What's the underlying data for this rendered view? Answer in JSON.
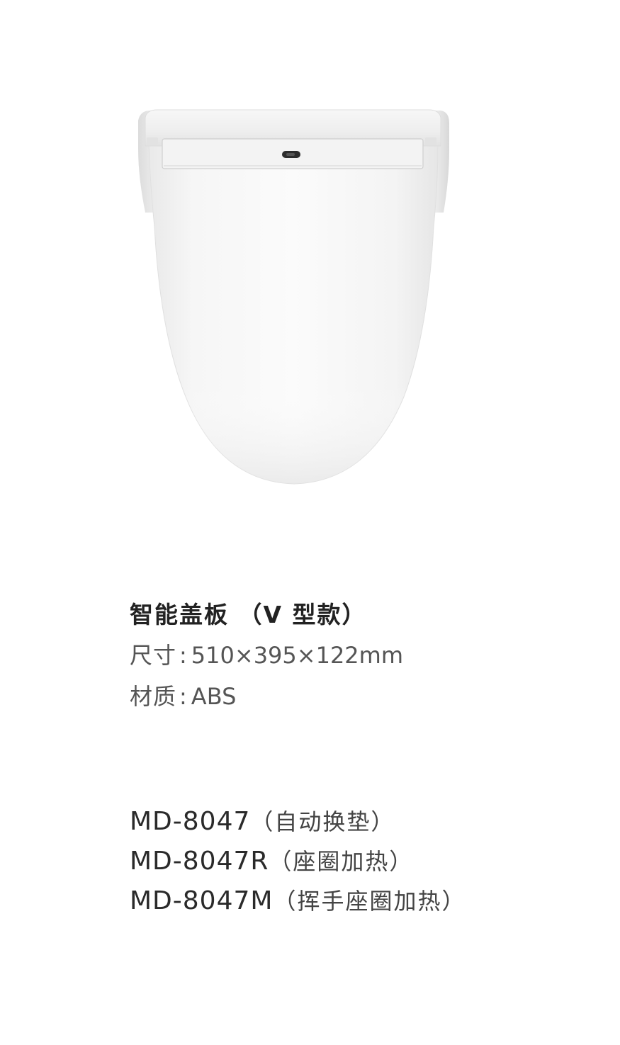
{
  "product": {
    "title": "智能盖板 （V 型款）",
    "specs": [
      {
        "label": "尺寸",
        "sep": ":",
        "value": "510×395×122mm"
      },
      {
        "label": "材质",
        "sep": ":",
        "value": "ABS"
      }
    ],
    "models": [
      {
        "code": "MD-8047",
        "desc": "（自动换垫）"
      },
      {
        "code": "MD-8047R",
        "desc": "（座圈加热）"
      },
      {
        "code": "MD-8047M",
        "desc": "（挥手座圈加热）"
      }
    ]
  },
  "colors": {
    "background": "#ffffff",
    "product_white": "#f2f2f2",
    "title_text": "#222222",
    "spec_text": "#555555"
  }
}
